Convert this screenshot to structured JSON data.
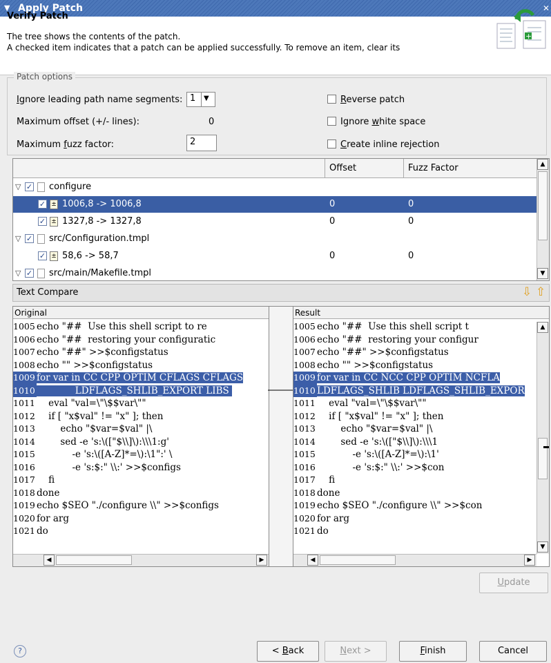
{
  "window": {
    "title": "Apply Patch",
    "menu_icon": "▼",
    "close_icon": "✕"
  },
  "header": {
    "title": "Verify Patch",
    "line1": "The tree shows the contents of the patch.",
    "line2": "A checked item indicates that a patch can be applied successfully. To remove an item, clear its"
  },
  "options": {
    "legend": "Patch options",
    "ignore_label_pre": "",
    "ignore_label_u": "I",
    "ignore_label_post": "gnore leading path name segments:",
    "ignore_value": "1",
    "max_offset_label": "Maximum offset (+/- lines):",
    "max_offset_value": "0",
    "fuzz_pre": "Maximum ",
    "fuzz_u": "f",
    "fuzz_post": "uzz factor:",
    "fuzz_value": "2",
    "reverse_u": "R",
    "reverse_post": "everse patch",
    "whitespace_pre": "Ignore ",
    "whitespace_u": "w",
    "whitespace_post": "hite space",
    "inline_u": "C",
    "inline_post": "reate inline rejection"
  },
  "tree": {
    "columns": [
      "",
      "Offset",
      "Fuzz Factor"
    ],
    "rows": [
      {
        "label": "configure",
        "offset": "",
        "fuzz": ""
      },
      {
        "label": "1006,8 -> 1006,8",
        "offset": "0",
        "fuzz": "0"
      },
      {
        "label": "1327,8 -> 1327,8",
        "offset": "0",
        "fuzz": "0"
      },
      {
        "label": "src/Configuration.tmpl",
        "offset": "",
        "fuzz": ""
      },
      {
        "label": "58,6 -> 58,7",
        "offset": "0",
        "fuzz": "0"
      },
      {
        "label": "src/main/Makefile.tmpl",
        "offset": "",
        "fuzz": ""
      }
    ]
  },
  "text_compare": {
    "label": "Text Compare",
    "down_icon": "⇩",
    "up_icon": "⇧"
  },
  "original": {
    "header": "Original",
    "lines": [
      [
        "1005",
        "echo \"##  Use this shell script to re"
      ],
      [
        "1006",
        "echo \"##  restoring your configuratic"
      ],
      [
        "1007",
        "echo \"##\" >>$configstatus"
      ],
      [
        "1008",
        "echo \"\" >>$configstatus"
      ],
      [
        "1009",
        "for var in CC CPP OPTIM CFLAGS CFLAGS"
      ],
      [
        "1010",
        "             LDFLAGS_SHLIB_EXPORT LIBS "
      ],
      [
        "1011",
        "    eval \"val=\\\"\\$$var\\\"\""
      ],
      [
        "1012",
        "    if [ \"x$val\" != \"x\" ]; then"
      ],
      [
        "1013",
        "        echo \"$var=$val\" |\\"
      ],
      [
        "1014",
        "        sed -e 's:\\([\"$\\\\]\\):\\\\\\1:g' "
      ],
      [
        "1015",
        "            -e 's:\\([A-Z]*=\\):\\1\":' \\"
      ],
      [
        "1016",
        "            -e 's:$:\" \\\\:' >>$configs"
      ],
      [
        "1017",
        "    fi"
      ],
      [
        "1018",
        "done"
      ],
      [
        "1019",
        "echo $SEO \"./configure \\\\\" >>$configs"
      ],
      [
        "1020",
        "for arg"
      ],
      [
        "1021",
        "do"
      ]
    ]
  },
  "result": {
    "header": "Result",
    "lines": [
      [
        "1005",
        "echo \"##  Use this shell script t"
      ],
      [
        "1006",
        "echo \"##  restoring your configur"
      ],
      [
        "1007",
        "echo \"##\" >>$configstatus"
      ],
      [
        "1008",
        "echo \"\" >>$configstatus"
      ],
      [
        "1009",
        "for var in CC NCC CPP OPTIM NCFLA"
      ],
      [
        "1010",
        "LDFLAGS_SHLIB LDFLAGS_SHLIB_EXPOR"
      ],
      [
        "1011",
        "    eval \"val=\\\"\\$$var\\\"\""
      ],
      [
        "1012",
        "    if [ \"x$val\" != \"x\" ]; then"
      ],
      [
        "1013",
        "        echo \"$var=$val\" |\\"
      ],
      [
        "1014",
        "        sed -e 's:\\([\"$\\\\]\\):\\\\\\1"
      ],
      [
        "1015",
        "            -e 's:\\([A-Z]*=\\):\\1'"
      ],
      [
        "1016",
        "            -e 's:$:\" \\\\:' >>$con"
      ],
      [
        "1017",
        "    fi"
      ],
      [
        "1018",
        "done"
      ],
      [
        "1019",
        "echo $SEO \"./configure \\\\\" >>$con"
      ],
      [
        "1020",
        "for arg"
      ],
      [
        "1021",
        "do"
      ]
    ]
  },
  "buttons": {
    "update_u": "U",
    "update_post": "pdate",
    "help_icon": "?",
    "back_pre": "< ",
    "back_u": "B",
    "back_post": "ack",
    "next_u": "N",
    "next_post": "ext >",
    "finish_u": "F",
    "finish_post": "inish",
    "cancel": "Cancel"
  },
  "scroll_icons": {
    "up": "▲",
    "down": "▼",
    "left": "◀",
    "right": "▶"
  }
}
